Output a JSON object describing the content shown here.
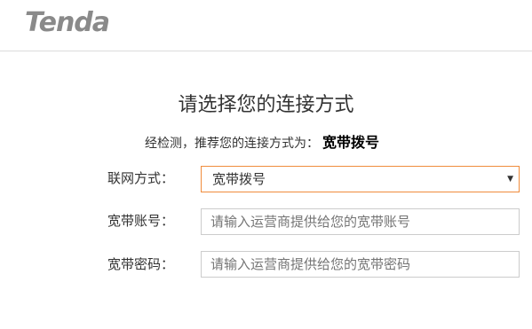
{
  "brand": {
    "logo_text": "Tenda"
  },
  "page": {
    "title": "请选择您的连接方式",
    "detect_prefix": "经检测，推荐您的连接方式为：",
    "detect_result": "宽带拨号"
  },
  "form": {
    "connection_type": {
      "label": "联网方式：",
      "selected": "宽带拨号"
    },
    "account": {
      "label": "宽带账号：",
      "value": "",
      "placeholder": "请输入运营商提供给您的宽带账号"
    },
    "password": {
      "label": "宽带密码：",
      "value": "",
      "placeholder": "请输入运营商提供给您的宽带密码"
    }
  },
  "colors": {
    "select_border": "#f08c3c",
    "logo": "#8a8a8a"
  }
}
